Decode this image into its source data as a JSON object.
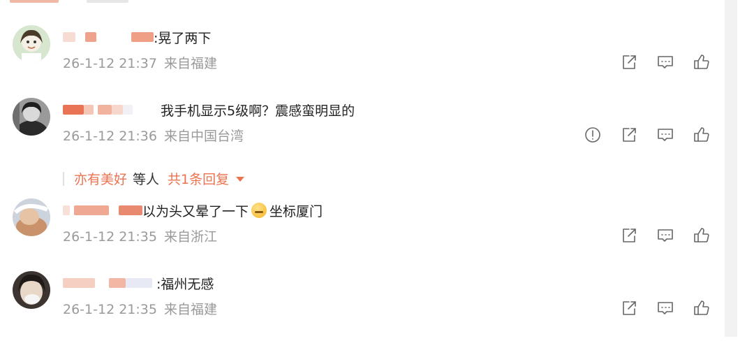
{
  "comments": [
    {
      "text": ":晃了两下",
      "timestamp": "26-1-12 21:37",
      "location": "来自福建",
      "actions": [
        "share-icon",
        "comment-icon",
        "like-icon"
      ]
    },
    {
      "text": "我手机显示5级啊？震感蛮明显的",
      "timestamp": "26-1-12 21:36",
      "location": "来自中国台湾",
      "actions": [
        "report-icon",
        "share-icon",
        "comment-icon",
        "like-icon"
      ],
      "reply_summary": {
        "user": "亦有美好",
        "middle": "等人",
        "count_text": "共1条回复"
      }
    },
    {
      "text_before": "以为头又晕了一下",
      "emoji": "dizzy-face-emoji",
      "text_after": " 坐标厦门",
      "timestamp": "26-1-12 21:35",
      "location": "来自浙江",
      "actions": [
        "share-icon",
        "comment-icon",
        "like-icon"
      ]
    },
    {
      "text": ":福州无感",
      "timestamp": "26-1-12 21:35",
      "location": "来自福建",
      "actions": [
        "share-icon",
        "comment-icon",
        "like-icon"
      ]
    }
  ],
  "colors": {
    "accent": "#eb7350",
    "meta_text": "#9a9a9a",
    "icon_stroke": "#666666"
  }
}
